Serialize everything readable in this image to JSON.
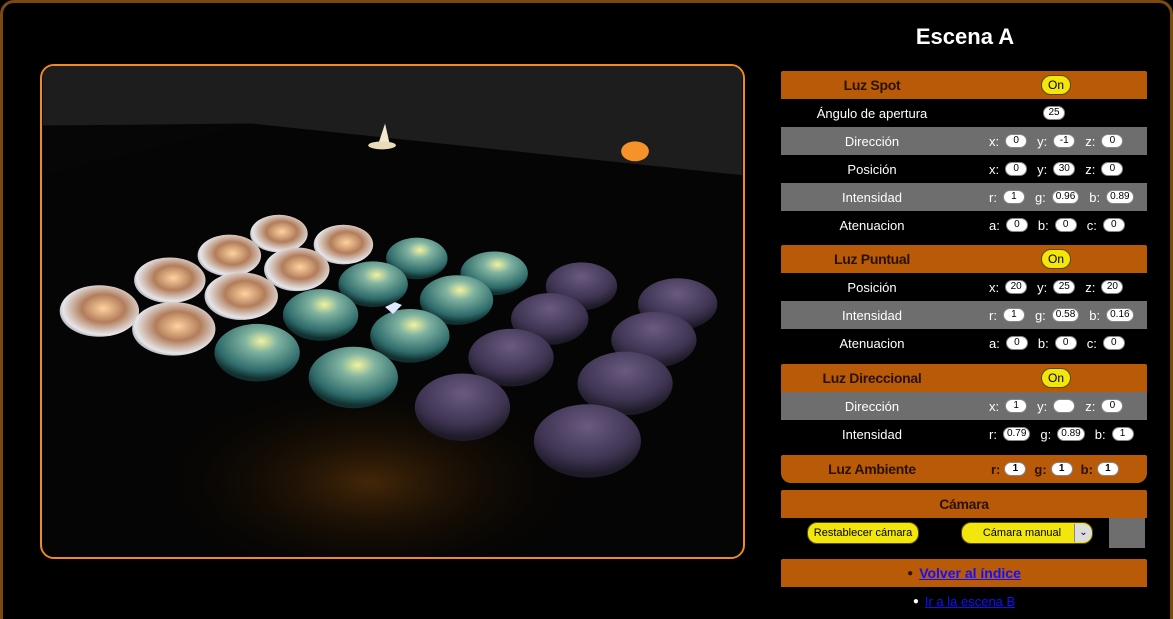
{
  "scene_title": "Escena A",
  "spot": {
    "title": "Luz Spot",
    "toggle": "On",
    "rows": {
      "angle": {
        "label": "Ángulo de apertura",
        "value": "25"
      },
      "direction": {
        "label": "Dirección",
        "a1": "x:",
        "v1": "0",
        "a2": "y:",
        "v2": "-1",
        "a3": "z:",
        "v3": "0"
      },
      "position": {
        "label": "Posición",
        "a1": "x:",
        "v1": "0",
        "a2": "y:",
        "v2": "30",
        "a3": "z:",
        "v3": "0"
      },
      "intensity": {
        "label": "Intensidad",
        "a1": "r:",
        "v1": "1",
        "a2": "g:",
        "v2": "0.96",
        "a3": "b:",
        "v3": "0.89"
      },
      "attenuation": {
        "label": "Atenuacion",
        "a1": "a:",
        "v1": "0",
        "a2": "b:",
        "v2": "0",
        "a3": "c:",
        "v3": "0"
      }
    }
  },
  "point": {
    "title": "Luz Puntual",
    "toggle": "On",
    "rows": {
      "position": {
        "label": "Posición",
        "a1": "x:",
        "v1": "20",
        "a2": "y:",
        "v2": "25",
        "a3": "z:",
        "v3": "20"
      },
      "intensity": {
        "label": "Intensidad",
        "a1": "r:",
        "v1": "1",
        "a2": "g:",
        "v2": "0.58",
        "a3": "b:",
        "v3": "0.16"
      },
      "attenuation": {
        "label": "Atenuacion",
        "a1": "a:",
        "v1": "0",
        "a2": "b:",
        "v2": "0",
        "a3": "c:",
        "v3": "0"
      }
    }
  },
  "directional": {
    "title": "Luz Direccional",
    "toggle": "On",
    "rows": {
      "direction": {
        "label": "Dirección",
        "a1": "x:",
        "v1": "1",
        "a2": "y:",
        "v2": "",
        "a3": "z:",
        "v3": "0"
      },
      "intensity": {
        "label": "Intensidad",
        "a1": "r:",
        "v1": "0.79",
        "a2": "g:",
        "v2": "0.89",
        "a3": "b:",
        "v3": "1"
      }
    }
  },
  "ambient": {
    "title": "Luz Ambiente",
    "a1": "r:",
    "v1": "1",
    "a2": "g:",
    "v2": "1",
    "a3": "b:",
    "v3": "1"
  },
  "camera": {
    "title": "Cámara",
    "reset_label": "Restablecer cámara",
    "mode_selected": "Cámara manual"
  },
  "links": {
    "back": "Volver al índice",
    "next": "Ir a la escena B"
  },
  "colors": {
    "accent": "#b85a08",
    "frame": "#f08a24",
    "button": "#f2e60c",
    "row_gray": "#6e6e6e",
    "link": "#1010ff"
  }
}
